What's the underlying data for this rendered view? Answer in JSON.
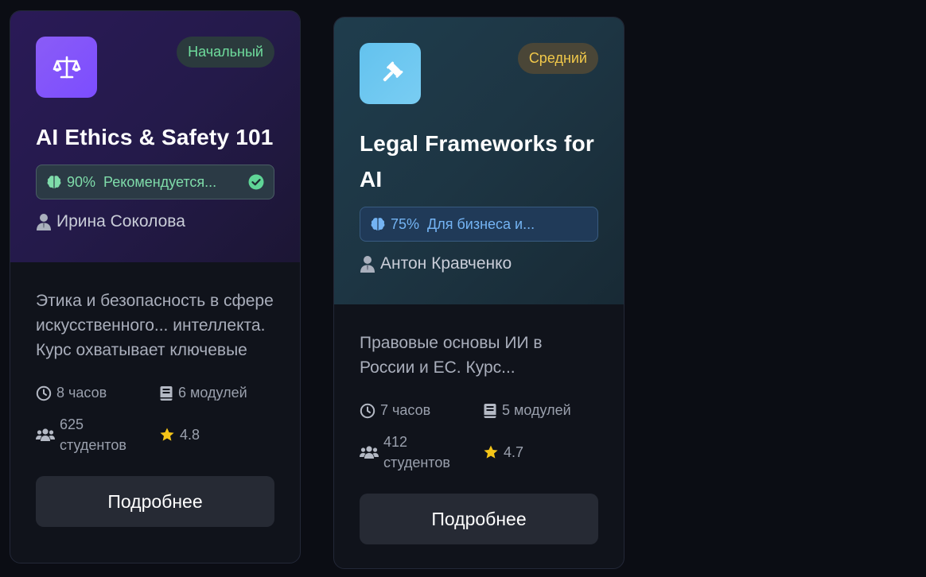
{
  "courses": [
    {
      "level": "Начальный",
      "title": "AI Ethics & Safety 101",
      "match_percent": "90%",
      "match_reason": "Рекомендуется...",
      "instructor": "Ирина Соколова",
      "description": "Этика и безопасность в сфере искусственного... интеллекта. Курс охватывает ключевые",
      "duration": "8 часов",
      "modules": "6 модулей",
      "students_count": "625",
      "students_label": "студентов",
      "rating": "4.8",
      "details_label": "Подробнее",
      "icon": "scales-icon"
    },
    {
      "level": "Средний",
      "title": "Legal Frameworks for AI",
      "match_percent": "75%",
      "match_reason": "Для бизнеса и...",
      "instructor": "Антон Кравченко",
      "description": "Правовые основы ИИ в России и ЕС. Курс...",
      "duration": "7 часов",
      "modules": "5 модулей",
      "students_count": "412",
      "students_label": "студентов",
      "rating": "4.7",
      "details_label": "Подробнее",
      "icon": "gavel-icon"
    }
  ],
  "colors": {
    "page_bg": "#0b0d14",
    "beginner_badge": "#6fdd9d",
    "intermediate_badge": "#f1c84a",
    "star": "#f5c518"
  }
}
